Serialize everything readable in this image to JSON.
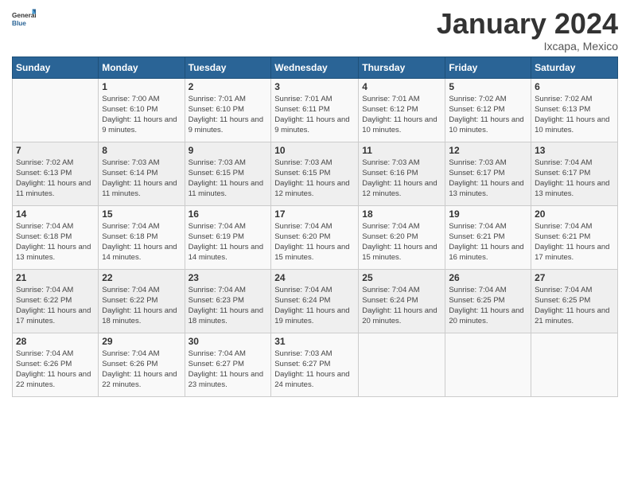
{
  "header": {
    "logo_general": "General",
    "logo_blue": "Blue",
    "month_year": "January 2024",
    "location": "Ixcapa, Mexico"
  },
  "weekdays": [
    "Sunday",
    "Monday",
    "Tuesday",
    "Wednesday",
    "Thursday",
    "Friday",
    "Saturday"
  ],
  "weeks": [
    [
      {
        "day": "",
        "sunrise": "",
        "sunset": "",
        "daylight": ""
      },
      {
        "day": "1",
        "sunrise": "Sunrise: 7:00 AM",
        "sunset": "Sunset: 6:10 PM",
        "daylight": "Daylight: 11 hours and 9 minutes."
      },
      {
        "day": "2",
        "sunrise": "Sunrise: 7:01 AM",
        "sunset": "Sunset: 6:10 PM",
        "daylight": "Daylight: 11 hours and 9 minutes."
      },
      {
        "day": "3",
        "sunrise": "Sunrise: 7:01 AM",
        "sunset": "Sunset: 6:11 PM",
        "daylight": "Daylight: 11 hours and 9 minutes."
      },
      {
        "day": "4",
        "sunrise": "Sunrise: 7:01 AM",
        "sunset": "Sunset: 6:12 PM",
        "daylight": "Daylight: 11 hours and 10 minutes."
      },
      {
        "day": "5",
        "sunrise": "Sunrise: 7:02 AM",
        "sunset": "Sunset: 6:12 PM",
        "daylight": "Daylight: 11 hours and 10 minutes."
      },
      {
        "day": "6",
        "sunrise": "Sunrise: 7:02 AM",
        "sunset": "Sunset: 6:13 PM",
        "daylight": "Daylight: 11 hours and 10 minutes."
      }
    ],
    [
      {
        "day": "7",
        "sunrise": "Sunrise: 7:02 AM",
        "sunset": "Sunset: 6:13 PM",
        "daylight": "Daylight: 11 hours and 11 minutes."
      },
      {
        "day": "8",
        "sunrise": "Sunrise: 7:03 AM",
        "sunset": "Sunset: 6:14 PM",
        "daylight": "Daylight: 11 hours and 11 minutes."
      },
      {
        "day": "9",
        "sunrise": "Sunrise: 7:03 AM",
        "sunset": "Sunset: 6:15 PM",
        "daylight": "Daylight: 11 hours and 11 minutes."
      },
      {
        "day": "10",
        "sunrise": "Sunrise: 7:03 AM",
        "sunset": "Sunset: 6:15 PM",
        "daylight": "Daylight: 11 hours and 12 minutes."
      },
      {
        "day": "11",
        "sunrise": "Sunrise: 7:03 AM",
        "sunset": "Sunset: 6:16 PM",
        "daylight": "Daylight: 11 hours and 12 minutes."
      },
      {
        "day": "12",
        "sunrise": "Sunrise: 7:03 AM",
        "sunset": "Sunset: 6:17 PM",
        "daylight": "Daylight: 11 hours and 13 minutes."
      },
      {
        "day": "13",
        "sunrise": "Sunrise: 7:04 AM",
        "sunset": "Sunset: 6:17 PM",
        "daylight": "Daylight: 11 hours and 13 minutes."
      }
    ],
    [
      {
        "day": "14",
        "sunrise": "Sunrise: 7:04 AM",
        "sunset": "Sunset: 6:18 PM",
        "daylight": "Daylight: 11 hours and 13 minutes."
      },
      {
        "day": "15",
        "sunrise": "Sunrise: 7:04 AM",
        "sunset": "Sunset: 6:18 PM",
        "daylight": "Daylight: 11 hours and 14 minutes."
      },
      {
        "day": "16",
        "sunrise": "Sunrise: 7:04 AM",
        "sunset": "Sunset: 6:19 PM",
        "daylight": "Daylight: 11 hours and 14 minutes."
      },
      {
        "day": "17",
        "sunrise": "Sunrise: 7:04 AM",
        "sunset": "Sunset: 6:20 PM",
        "daylight": "Daylight: 11 hours and 15 minutes."
      },
      {
        "day": "18",
        "sunrise": "Sunrise: 7:04 AM",
        "sunset": "Sunset: 6:20 PM",
        "daylight": "Daylight: 11 hours and 15 minutes."
      },
      {
        "day": "19",
        "sunrise": "Sunrise: 7:04 AM",
        "sunset": "Sunset: 6:21 PM",
        "daylight": "Daylight: 11 hours and 16 minutes."
      },
      {
        "day": "20",
        "sunrise": "Sunrise: 7:04 AM",
        "sunset": "Sunset: 6:21 PM",
        "daylight": "Daylight: 11 hours and 17 minutes."
      }
    ],
    [
      {
        "day": "21",
        "sunrise": "Sunrise: 7:04 AM",
        "sunset": "Sunset: 6:22 PM",
        "daylight": "Daylight: 11 hours and 17 minutes."
      },
      {
        "day": "22",
        "sunrise": "Sunrise: 7:04 AM",
        "sunset": "Sunset: 6:22 PM",
        "daylight": "Daylight: 11 hours and 18 minutes."
      },
      {
        "day": "23",
        "sunrise": "Sunrise: 7:04 AM",
        "sunset": "Sunset: 6:23 PM",
        "daylight": "Daylight: 11 hours and 18 minutes."
      },
      {
        "day": "24",
        "sunrise": "Sunrise: 7:04 AM",
        "sunset": "Sunset: 6:24 PM",
        "daylight": "Daylight: 11 hours and 19 minutes."
      },
      {
        "day": "25",
        "sunrise": "Sunrise: 7:04 AM",
        "sunset": "Sunset: 6:24 PM",
        "daylight": "Daylight: 11 hours and 20 minutes."
      },
      {
        "day": "26",
        "sunrise": "Sunrise: 7:04 AM",
        "sunset": "Sunset: 6:25 PM",
        "daylight": "Daylight: 11 hours and 20 minutes."
      },
      {
        "day": "27",
        "sunrise": "Sunrise: 7:04 AM",
        "sunset": "Sunset: 6:25 PM",
        "daylight": "Daylight: 11 hours and 21 minutes."
      }
    ],
    [
      {
        "day": "28",
        "sunrise": "Sunrise: 7:04 AM",
        "sunset": "Sunset: 6:26 PM",
        "daylight": "Daylight: 11 hours and 22 minutes."
      },
      {
        "day": "29",
        "sunrise": "Sunrise: 7:04 AM",
        "sunset": "Sunset: 6:26 PM",
        "daylight": "Daylight: 11 hours and 22 minutes."
      },
      {
        "day": "30",
        "sunrise": "Sunrise: 7:04 AM",
        "sunset": "Sunset: 6:27 PM",
        "daylight": "Daylight: 11 hours and 23 minutes."
      },
      {
        "day": "31",
        "sunrise": "Sunrise: 7:03 AM",
        "sunset": "Sunset: 6:27 PM",
        "daylight": "Daylight: 11 hours and 24 minutes."
      },
      {
        "day": "",
        "sunrise": "",
        "sunset": "",
        "daylight": ""
      },
      {
        "day": "",
        "sunrise": "",
        "sunset": "",
        "daylight": ""
      },
      {
        "day": "",
        "sunrise": "",
        "sunset": "",
        "daylight": ""
      }
    ]
  ]
}
